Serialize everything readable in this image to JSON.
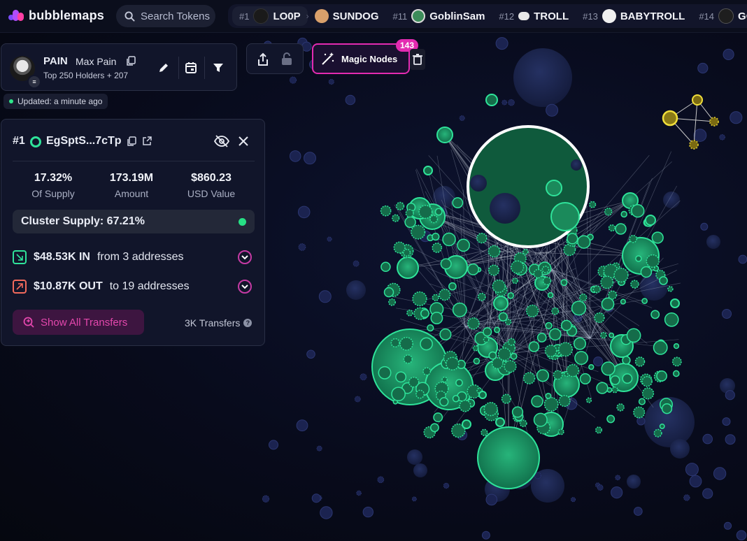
{
  "app": {
    "name": "bubblemaps"
  },
  "search": {
    "placeholder": "Search Tokens"
  },
  "ticker": [
    {
      "rank": "#1",
      "symbol": "LO0P",
      "color": "#1a1a1a"
    },
    {
      "rank": "",
      "symbol": "SUNDOG",
      "color": "#d9a06b"
    },
    {
      "rank": "#11",
      "symbol": "GoblinSam",
      "color": "#3c8c5a"
    },
    {
      "rank": "#12",
      "symbol": "TROLL",
      "color": "#e8e8e8"
    },
    {
      "rank": "#13",
      "symbol": "BABYTROLL",
      "color": "#f0f0f0"
    },
    {
      "rank": "#14",
      "symbol": "GO",
      "color": "#1e1e1e"
    }
  ],
  "token": {
    "symbol": "PAIN",
    "name": "Max Pain",
    "subtitle": "Top 250 Holders + 207"
  },
  "updated": "Updated: a minute ago",
  "magic": {
    "label": "Magic Nodes",
    "count": "143"
  },
  "holder": {
    "rank": "#1",
    "address": "EgSptS...7cTp",
    "stats": [
      {
        "value": "17.32%",
        "label": "Of Supply"
      },
      {
        "value": "173.19M",
        "label": "Amount"
      },
      {
        "value": "$860.23",
        "label": "USD Value"
      }
    ],
    "cluster": "Cluster Supply: 67.21%",
    "in": {
      "amount": "$48.53K IN",
      "desc": "from 3 addresses"
    },
    "out": {
      "amount": "$10.87K OUT",
      "desc": "to 19 addresses"
    },
    "show_all": "Show All Transfers",
    "transfers": "3K Transfers"
  },
  "colors": {
    "accent": "#e32bb1",
    "node": "#1fd583",
    "bg": "#080b1c"
  }
}
